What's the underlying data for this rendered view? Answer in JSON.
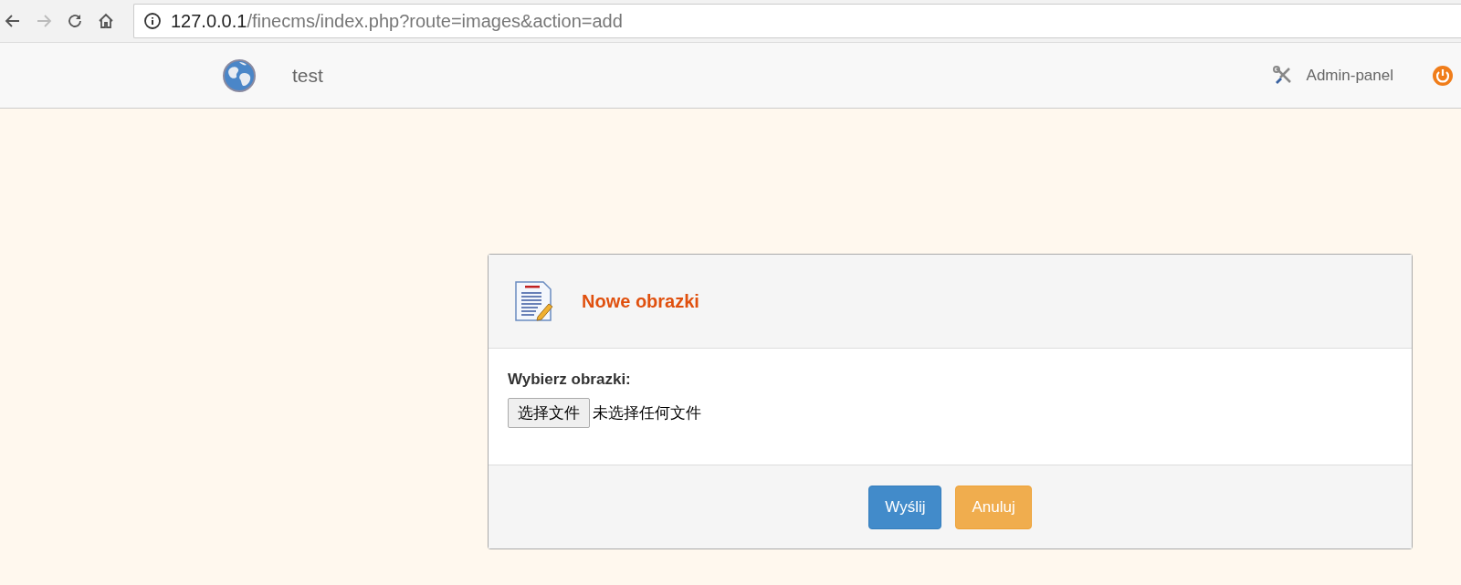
{
  "browser": {
    "url_host": "127.0.0.1",
    "url_path": "/finecms/index.php?route=images&action=add"
  },
  "navbar": {
    "brand": "test",
    "admin_link": "Admin-panel"
  },
  "panel": {
    "title": "Nowe obrazki",
    "field_label": "Wybierz obrazki:",
    "file_button": "选择文件",
    "file_status": "未选择任何文件",
    "buttons": [
      {
        "label": "Wyślij",
        "kind": "primary"
      },
      {
        "label": "Anuluj",
        "kind": "warning"
      }
    ]
  }
}
